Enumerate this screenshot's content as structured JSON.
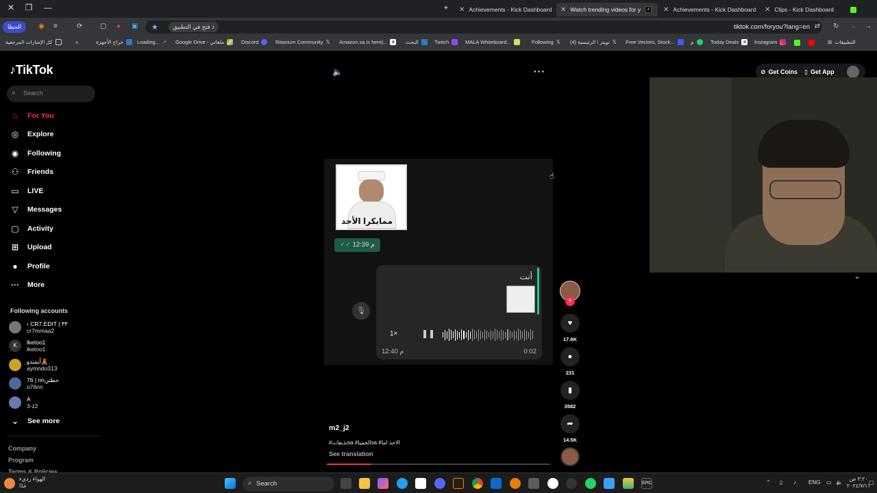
{
  "browser": {
    "tabs": [
      {
        "label": "Achievements - Kick Dashboard",
        "active": false
      },
      {
        "label": "Watch trending videos for y",
        "active": true
      },
      {
        "label": "Achievements - Kick Dashboard",
        "active": false
      },
      {
        "label": "Clips - Kick Dashboard",
        "active": false
      }
    ],
    "address_pill": "الحظا",
    "open_app_chip": "فتح في التطبيق",
    "url": "tiktok.com/foryou?lang=en",
    "bookmarks": [
      "كل الإشارات المرجعية",
      "حراج الأجهزة",
      "Loading...",
      "Google Drive - ملفاتي",
      "Discord",
      "Ritanium Community",
      "Amazon.sa is here|...",
      "البحث",
      "Twitch",
      "MALA Whiteboard...",
      "Following",
      "(4) تويتر \\ الرئيسية",
      "Free Vectors, Stock...",
      "م",
      "Today Deals",
      "Instagram",
      "التطبيقات"
    ]
  },
  "sidebar": {
    "logo": "TikTok",
    "search_placeholder": "Search",
    "nav": [
      {
        "label": "For You",
        "icon": "home-icon",
        "active": true
      },
      {
        "label": "Explore",
        "icon": "compass-icon"
      },
      {
        "label": "Following",
        "icon": "following-icon"
      },
      {
        "label": "Friends",
        "icon": "friends-icon"
      },
      {
        "label": "LIVE",
        "icon": "live-icon"
      },
      {
        "label": "Messages",
        "icon": "messages-icon"
      },
      {
        "label": "Activity",
        "icon": "activity-icon"
      },
      {
        "label": "Upload",
        "icon": "upload-icon"
      },
      {
        "label": "Profile",
        "icon": "profile-icon"
      },
      {
        "label": "More",
        "icon": "more-icon"
      }
    ],
    "following_header": "Following accounts",
    "accounts": [
      {
        "name": "‹ CR7.EDIT | ٣٣",
        "handle": "cr7mmaa2"
      },
      {
        "name": "lketoo1",
        "handle": "lketoo1"
      },
      {
        "name": "أيمندو🧸",
        "handle": "aymndo313"
      },
      {
        "name": "76 | nnحطتن",
        "handle": "o76nn"
      },
      {
        "name": "A",
        "handle": "3-z2"
      }
    ],
    "see_more": "See more",
    "footer": [
      "Company",
      "Program",
      "Terms & Policies"
    ]
  },
  "video": {
    "sticker_text": "ممابكرا الأحد",
    "time_bubble": "12:39 م",
    "quoted_label": "أنت",
    "speed": "1×",
    "time_sent": "12:40 م",
    "duration": "0:02",
    "author": "m2_j2",
    "caption": "#تذيقاتsa #الحمياsa #الاحد اما",
    "see_translation": "See translation",
    "progress": 0.2
  },
  "actions": {
    "likes": "17.6K",
    "comments": "231",
    "saves": "3582",
    "shares": "14.5K"
  },
  "topright": {
    "get_coins": "Get Coins",
    "get_app": "Get App"
  },
  "taskbar": {
    "search": "Search",
    "weather_line1": "الهواء رديء",
    "weather_line2": "غدًا",
    "lang": "ENG",
    "time": "٣:٢٠ ص",
    "date": "٢٠٢٤/٧/١١"
  }
}
